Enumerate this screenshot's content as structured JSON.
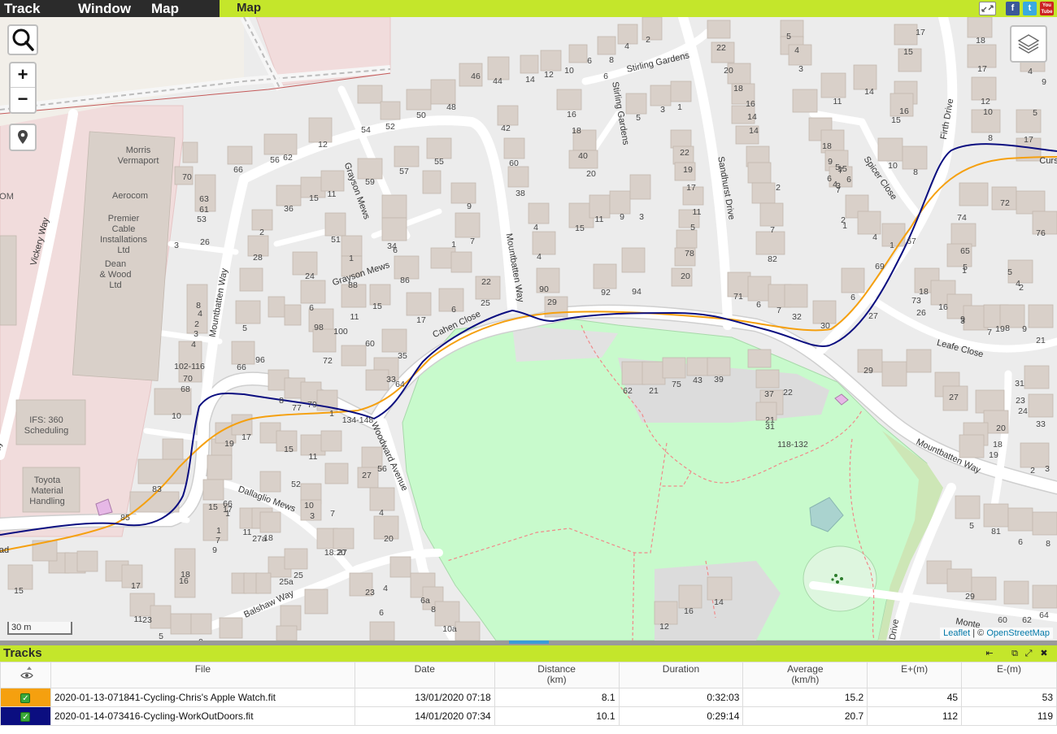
{
  "menu": {
    "items": [
      "Track",
      "Window",
      "Map"
    ],
    "active_tab": "Map",
    "fullscreen_icon": "fullscreen-icon",
    "facebook": "f",
    "twitter": "t",
    "youtube": "You Tube"
  },
  "colors": {
    "menu_bar": "#c4e62b",
    "menu_dark": "#2b2b2b",
    "track1": "#f5a00f",
    "track2": "#0b0e80",
    "park": "#c8facc"
  },
  "map": {
    "zoom_in": "+",
    "zoom_out": "−",
    "scale": "30 m",
    "attribution": {
      "leaflet": "Leaflet",
      "separator": " | © ",
      "osm": "OpenStreetMap"
    },
    "roads": [
      "Stirling Gardens",
      "Stirling Gardens",
      "Sandhurst Drive",
      "Firth Drive",
      "Spicer Close",
      "Grayson Mews",
      "Grayson Mews",
      "Mountbatten Way",
      "Mountbatten Way",
      "Mountbatten Way",
      "Cahen Close",
      "Woodward Avenue",
      "Dallaglio Mews",
      "Balshaw Way",
      "Leafe Close",
      "Vickery Way",
      "Curs",
      "Way",
      "ad",
      "Drive",
      "Monte"
    ],
    "businesses": [
      [
        "Morris",
        "Vermaport"
      ],
      [
        "Aerocom"
      ],
      [
        "Premier",
        "Cable",
        "Installations",
        "Ltd"
      ],
      [
        "Dean",
        "& Wood",
        "Ltd"
      ],
      [
        "IFS: 360",
        "Scheduling"
      ],
      [
        "Toyota",
        "Material",
        "Handling"
      ],
      [
        "OM"
      ]
    ],
    "house_numbers": [
      "5",
      "4",
      "2",
      "6",
      "8",
      "4",
      "22",
      "17",
      "18",
      "17",
      "15",
      "9",
      "3",
      "4",
      "5",
      "46",
      "44",
      "14",
      "12",
      "10",
      "6",
      "20",
      "18",
      "16",
      "14",
      "11",
      "14",
      "16",
      "18",
      "12",
      "10",
      "8",
      "54",
      "52",
      "50",
      "48",
      "42",
      "5",
      "3",
      "1",
      "14",
      "16",
      "15",
      "12",
      "56",
      "62",
      "60",
      "40",
      "20",
      "22",
      "19",
      "17",
      "15",
      "10",
      "8",
      "17",
      "18",
      "9",
      "6",
      "7",
      "5",
      "4",
      "70",
      "66",
      "59",
      "57",
      "55",
      "38",
      "11",
      "7",
      "6",
      "3",
      "2",
      "15",
      "11",
      "9",
      "5",
      "7",
      "72",
      "74",
      "76",
      "65",
      "63",
      "61",
      "53",
      "36",
      "15",
      "11",
      "9",
      "4",
      "3",
      "1",
      "4",
      "2",
      "1",
      "67",
      "1",
      "2",
      "51",
      "34",
      "7",
      "2",
      "1",
      "6",
      "4",
      "78",
      "82",
      "69",
      "5",
      "4",
      "5",
      "3",
      "26",
      "28",
      "1",
      "24",
      "22",
      "20",
      "18",
      "16",
      "3",
      "7",
      "8",
      "9",
      "6",
      "71",
      "6",
      "7",
      "32",
      "30",
      "86",
      "88",
      "90",
      "92",
      "94",
      "73",
      "9",
      "19",
      "21",
      "8",
      "4",
      "2",
      "3",
      "4",
      "5",
      "6",
      "11",
      "15",
      "17",
      "6",
      "25",
      "29",
      "27",
      "26",
      "96",
      "98",
      "100",
      "72",
      "60",
      "35",
      "33",
      "31",
      "29",
      "27",
      "23",
      "24",
      "20",
      "18",
      "19",
      "102-116",
      "70",
      "68",
      "66",
      "64",
      "62",
      "21",
      "75",
      "43",
      "39",
      "37",
      "22",
      "21",
      "118-132",
      "33",
      "10",
      "8",
      "77",
      "79",
      "1",
      "134-148",
      "31",
      "19",
      "17",
      "15",
      "11",
      "2",
      "3",
      "5",
      "81",
      "83",
      "85",
      "4",
      "6",
      "8",
      "29",
      "60",
      "62",
      "64",
      "56",
      "52",
      "7",
      "17",
      "66",
      "1",
      "15",
      "10",
      "3",
      "1",
      "7",
      "9",
      "11",
      "27a",
      "18",
      "20",
      "27",
      "25a",
      "25",
      "18:20",
      "27",
      "23",
      "4",
      "6",
      "6a",
      "8",
      "10a",
      "14",
      "16",
      "12",
      "11",
      "23",
      "5",
      "9",
      "1",
      "3",
      "5",
      "1",
      "18",
      "16",
      "17",
      "15"
    ]
  },
  "tracks_panel": {
    "title": "Tracks",
    "buttons": [
      "⇤",
      "⧉",
      "⤢",
      "✖"
    ],
    "visibility_icon": "eye-icon",
    "columns": [
      {
        "label": "File",
        "unit": ""
      },
      {
        "label": "Date",
        "unit": ""
      },
      {
        "label": "Distance",
        "unit": "(km)"
      },
      {
        "label": "Duration",
        "unit": ""
      },
      {
        "label": "Average",
        "unit": "(km/h)"
      },
      {
        "label": "E+(m)",
        "unit": ""
      },
      {
        "label": "E-(m)",
        "unit": ""
      }
    ],
    "rows": [
      {
        "color": "#f5a00f",
        "file": "2020-01-13-071841-Cycling-Chris's Apple Watch.fit",
        "date": "13/01/2020 07:18",
        "distance": "8.1",
        "duration": "0:32:03",
        "average": "15.2",
        "eplus": "45",
        "eminus": "53"
      },
      {
        "color": "#0b0e80",
        "file": "2020-01-14-073416-Cycling-WorkOutDoors.fit",
        "date": "14/01/2020 07:34",
        "distance": "10.1",
        "duration": "0:29:14",
        "average": "20.7",
        "eplus": "112",
        "eminus": "119"
      }
    ]
  }
}
